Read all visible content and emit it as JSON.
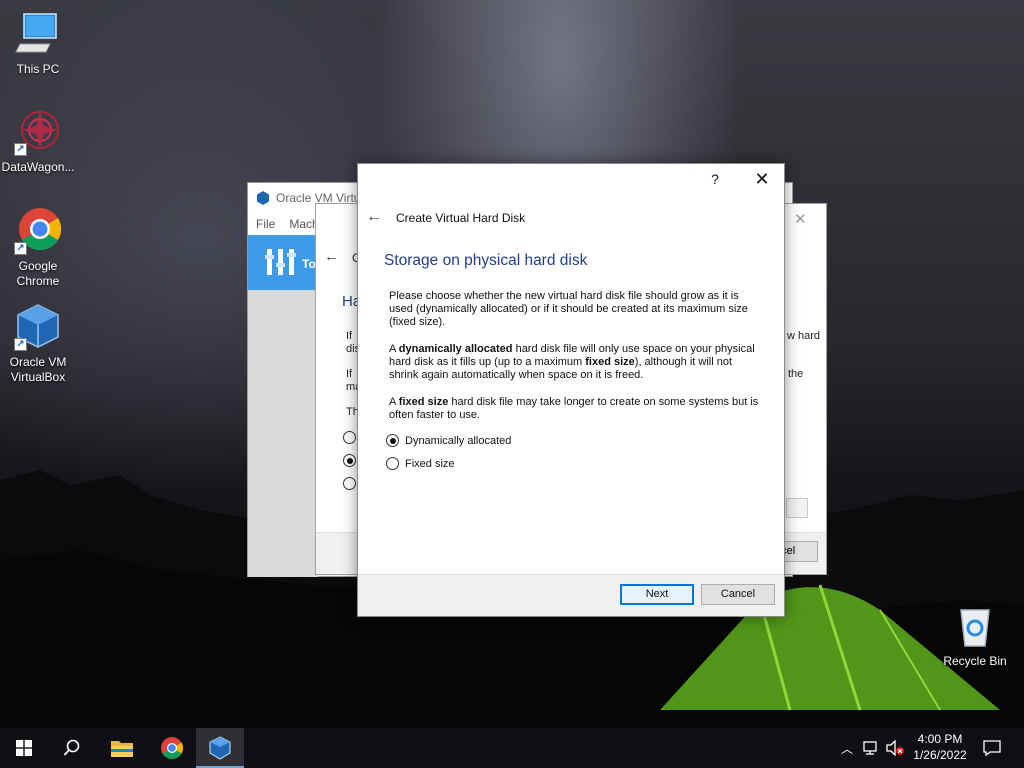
{
  "desktop": {
    "icons": [
      {
        "label": "This PC"
      },
      {
        "label": "DataWagon..."
      },
      {
        "label": "Google Chrome"
      },
      {
        "label": "Oracle VM VirtualBox"
      },
      {
        "label": "Recycle Bin"
      }
    ]
  },
  "vbox_manager": {
    "title": "Oracle VM Virtu",
    "menu": [
      "File",
      "Mach"
    ],
    "toolbar_label": "To"
  },
  "middle_wizard": {
    "heading": "Ha",
    "frag_if1": "If",
    "frag_dis": "dis",
    "frag_if2": "If",
    "frag_ma": "ma",
    "frag_th": "Th",
    "frag_right1": "w hard",
    "frag_right2": "the",
    "frag_cancel": "ncel",
    "frag_c": "C"
  },
  "dialog": {
    "help": "?",
    "close": "✕",
    "wizard_title": "Create Virtual Hard Disk",
    "section_heading": "Storage on physical hard disk",
    "para1": "Please choose whether the new virtual hard disk file should grow as it is used (dynamically allocated) or if it should be created at its maximum size (fixed size).",
    "para2": {
      "a": "A ",
      "b": "dynamically allocated",
      "c": " hard disk file will only use space on your physical hard disk as it fills up (up to a maximum ",
      "d": "fixed size",
      "e": "), although it will not shrink again automatically when space on it is freed."
    },
    "para3": {
      "a": "A ",
      "b": "fixed size",
      "c": " hard disk file may take longer to create on some systems but is often faster to use."
    },
    "options": [
      {
        "label": "Dynamically allocated",
        "checked": true
      },
      {
        "label": "Fixed size",
        "checked": false
      }
    ],
    "next_label": "Next",
    "cancel_label": "Cancel"
  },
  "taskbar": {
    "time": "4:00 PM",
    "date": "1/26/2022"
  },
  "colors": {
    "accent": "#0078d7",
    "heading_blue": "#1f3f8a",
    "vbox_blue": "#3d9ae6"
  }
}
